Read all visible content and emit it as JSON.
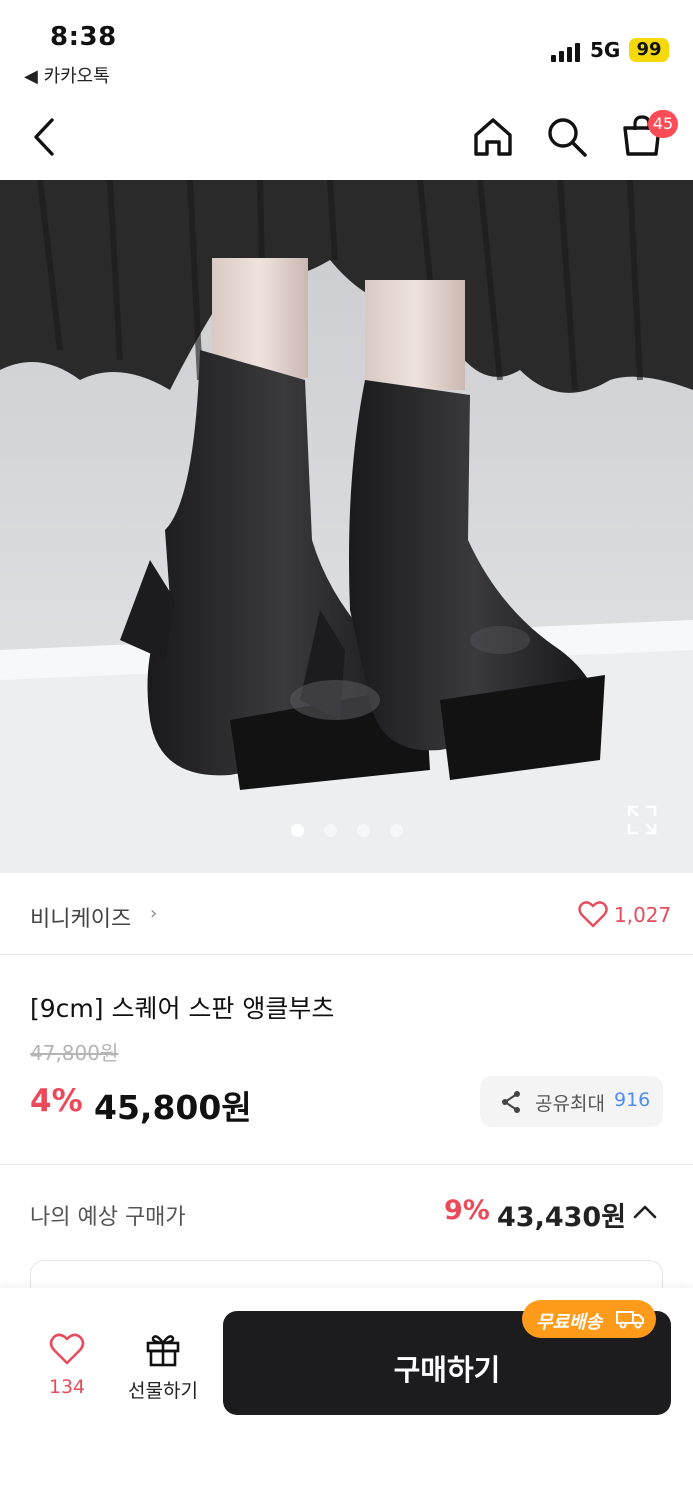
{
  "status_bar": {
    "time": "8:38",
    "back_app": "◀ 카카오톡",
    "network": "5G",
    "battery": "99"
  },
  "nav": {
    "cart_badge": "45",
    "icons": [
      "back-chevron-icon",
      "home-icon",
      "search-icon",
      "shopping-bag-icon"
    ]
  },
  "hero": {
    "image_description_icon": "product-photo",
    "total_slides": 4,
    "active_slide": 1
  },
  "brand": {
    "name": "비니케이즈",
    "chevron": "›",
    "like_count": "1,027"
  },
  "product": {
    "title": "[9cm] 스퀘어 스판 앵클부츠",
    "original_price": "47,800원",
    "discount_rate": "4%",
    "price": "45,800원",
    "share_label": "공유최대",
    "share_amount": "916"
  },
  "expected": {
    "label": "나의 예상 구매가",
    "discount_rate": "9%",
    "price": "43,430원"
  },
  "bottom": {
    "wish_count": "134",
    "gift_label": "선물하기",
    "buy_label": "구매하기",
    "free_shipping": "무료배송"
  },
  "colors": {
    "accent_red": "#ec4a59",
    "badge_red": "#ff4d57",
    "share_blue": "#4f8ef7",
    "free_ship_orange": "#ff9b1a",
    "buy_button": "#1c1c1e",
    "battery_yellow": "#f5d90a"
  }
}
